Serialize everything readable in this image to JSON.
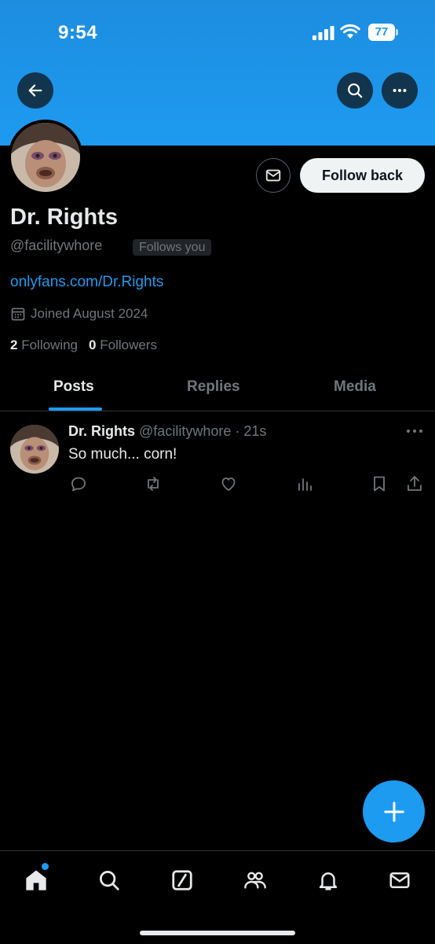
{
  "status_bar": {
    "time": "9:54",
    "battery": "77"
  },
  "profile": {
    "display_name": "Dr. Rights",
    "handle": "@facilitywhore",
    "follows_you": "Follows you",
    "link": "onlyfans.com/Dr.Rights",
    "joined": "Joined August 2024",
    "following_count": "2",
    "following_label": "Following",
    "followers_count": "0",
    "followers_label": "Followers",
    "follow_button": "Follow back"
  },
  "tabs": [
    {
      "label": "Posts",
      "active": true
    },
    {
      "label": "Replies",
      "active": false
    },
    {
      "label": "Media",
      "active": false
    }
  ],
  "post": {
    "author": "Dr. Rights",
    "meta": "@facilitywhore · 21s",
    "text": "So much... corn!"
  },
  "icons": {
    "back": "arrow-left-icon",
    "search": "search-icon",
    "more": "more-horizontal-icon",
    "message": "envelope-icon",
    "compose": "plus-icon",
    "nav": [
      "home-icon",
      "search-icon",
      "grok-icon",
      "communities-icon",
      "bell-icon",
      "envelope-icon"
    ]
  },
  "colors": {
    "accent": "#1d9bf0",
    "background": "#000000",
    "muted": "#71767b"
  }
}
